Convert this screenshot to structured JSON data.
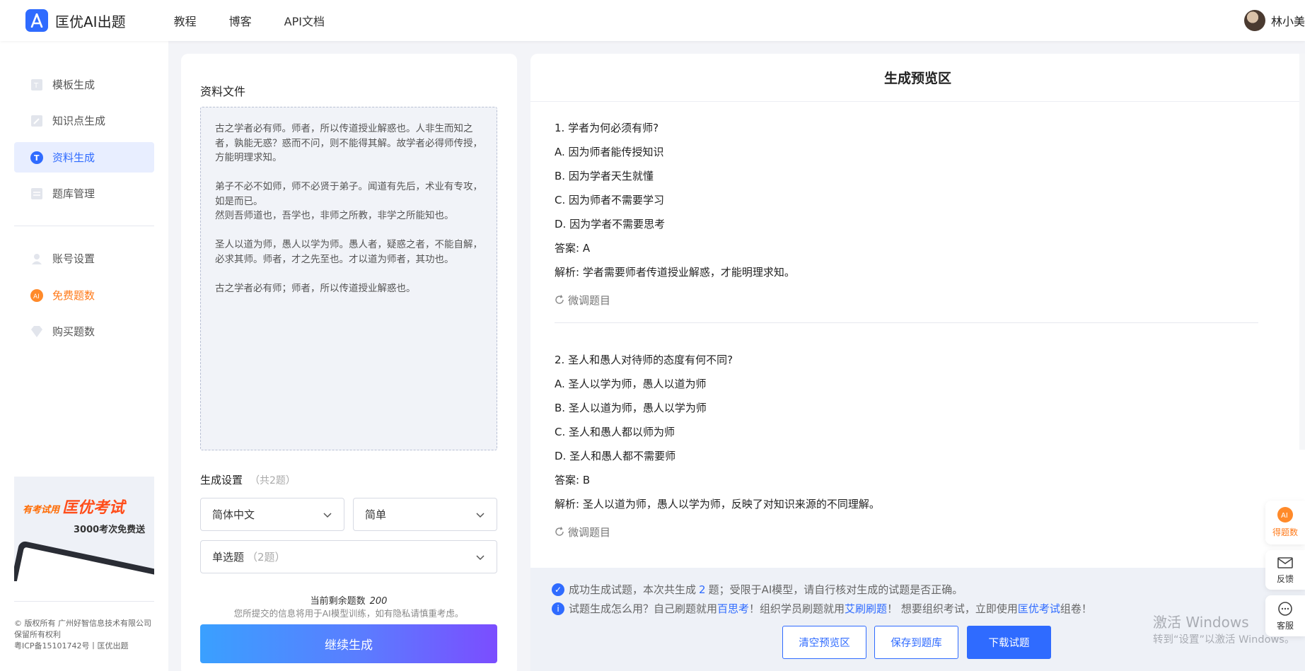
{
  "header": {
    "brand": "匡优AI出题",
    "nav": [
      "教程",
      "博客",
      "API文档"
    ],
    "user_name": "林小美"
  },
  "sidebar": {
    "items": [
      {
        "label": "模板生成",
        "icon": "template-icon"
      },
      {
        "label": "知识点生成",
        "icon": "pen-icon"
      },
      {
        "label": "资料生成",
        "icon": "text-icon"
      },
      {
        "label": "题库管理",
        "icon": "bank-icon"
      },
      {
        "label": "账号设置",
        "icon": "user-icon"
      },
      {
        "label": "免费题数",
        "icon": "ai-coin-icon"
      },
      {
        "label": "购买题数",
        "icon": "diamond-icon"
      }
    ],
    "promo": {
      "head_small": "有考试用",
      "head_big": "匡优考试",
      "sub": "3000考次免费送"
    },
    "footer": [
      "© 版权所有 广州好智信息技术有限公司",
      "保留所有权利",
      "粤ICP备15101742号丨匡优出题"
    ]
  },
  "left_panel": {
    "section_title": "资料文件",
    "material_text": "古之学者必有师。师者，所以传道授业解惑也。人非生而知之者，孰能无惑？惑而不问，则不能得其解。故学者必得师传授，方能明理求知。\n\n弟子不必不如师，师不必贤于弟子。闻道有先后，术业有专攻，如是而已。\n然则吾师道也，吾学也，非师之所教，非学之所能知也。\n\n圣人以道为师，愚人以学为师。愚人者，疑惑之者，不能自解，必求其师。师者，才之先至也。才以道为师者，其功也。\n\n古之学者必有师；师者，所以传道授业解惑也。",
    "settings_title": "生成设置",
    "settings_hint": "（共2题）",
    "language": "简体中文",
    "difficulty": "简单",
    "question_type": "单选题",
    "question_type_hint": "（2题）",
    "remaining_label": "当前剩余题数",
    "remaining_value": "200",
    "privacy_note": "您所提交的信息将用于AI模型训练，如有隐私请慎重考虑。",
    "continue_button": "继续生成"
  },
  "preview": {
    "title": "生成预览区",
    "refine_label": "微调题目",
    "questions": [
      {
        "stem": "1. 学者为何必须有师?",
        "options": [
          "A. 因为师者能传授知识",
          "B. 因为学者天生就懂",
          "C. 因为师者不需要学习",
          "D. 因为学者不需要思考"
        ],
        "answer": "答案: A",
        "analysis": "解析: 学者需要师者传道授业解惑，才能明理求知。"
      },
      {
        "stem": "2. 圣人和愚人对待师的态度有何不同?",
        "options": [
          "A. 圣人以学为师，愚人以道为师",
          "B. 圣人以道为师，愚人以学为师",
          "C. 圣人和愚人都以师为师",
          "D. 圣人和愚人都不需要师"
        ],
        "answer": "答案: B",
        "analysis": "解析: 圣人以道为师，愚人以学为师，反映了对知识来源的不同理解。"
      }
    ],
    "notice1_a": "成功生成试题，本次共生成",
    "notice1_count": "2",
    "notice1_b": "题；受限于AI模型，请自行核对生成的试题是否正确。",
    "notice2_a": "试题生成怎么用？自己刷题就用",
    "notice2_link1": "百思考",
    "notice2_b": "！组织学员刷题就用",
    "notice2_link2": "艾刷刷题",
    "notice2_c": "！ 想要组织考试，立即使用",
    "notice2_link3": "匡优考试",
    "notice2_d": "组卷！",
    "buttons": {
      "clear": "清空预览区",
      "save": "保存到题库",
      "download": "下载试题"
    }
  },
  "floating": {
    "points": "得题数",
    "feedback": "反馈",
    "service": "客服"
  },
  "watermark": {
    "line1": "激活 Windows",
    "line2": "转到“设置”以激活 Windows。"
  },
  "colors": {
    "primary": "#2f6bff",
    "orange": "#ff7a1a",
    "bg": "#f3f4f8"
  }
}
